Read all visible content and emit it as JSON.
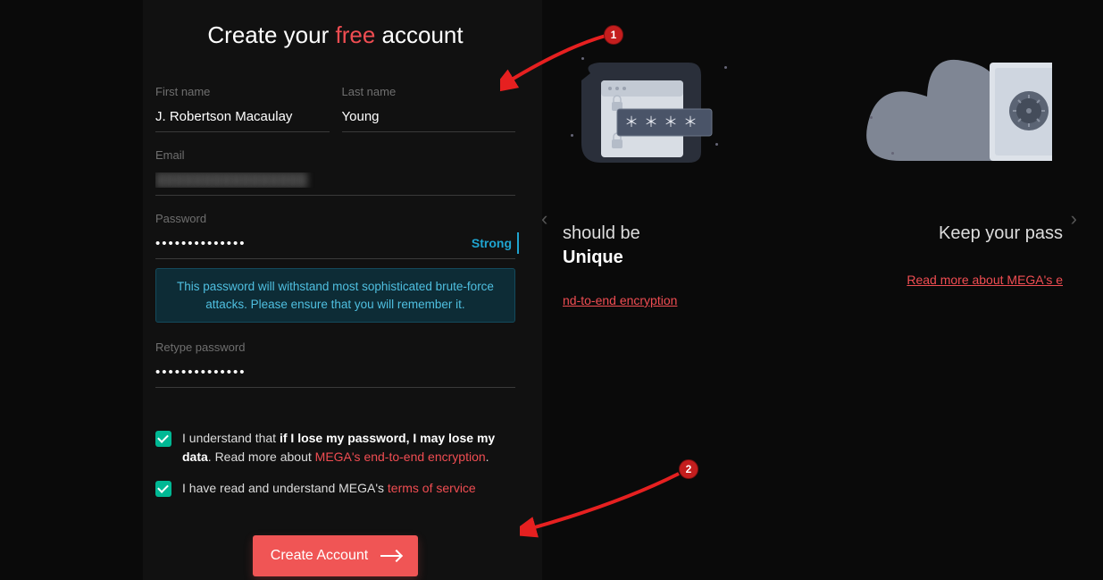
{
  "title": {
    "pre": "Create your ",
    "highlight": "free",
    "post": " account"
  },
  "fields": {
    "first_name": {
      "label": "First name",
      "value": "J. Robertson Macaulay"
    },
    "last_name": {
      "label": "Last name",
      "value": "Young"
    },
    "email": {
      "label": "Email",
      "value": "████████████████"
    },
    "password": {
      "label": "Password",
      "value": "••••••••••••••",
      "strength": "Strong"
    },
    "retype": {
      "label": "Retype password",
      "value": "••••••••••••••"
    }
  },
  "password_tip": "This password will withstand most sophisticated brute-force attacks. Please ensure that you will remember it.",
  "consent1": {
    "pre": "I understand that ",
    "bold": "if I lose my password, I may lose my data",
    "mid": ". Read more about ",
    "link": "MEGA's end-to-end encryption",
    "post": "."
  },
  "consent2": {
    "pre": "I have read and understand MEGA's ",
    "link": "terms of service"
  },
  "create_button": "Create Account",
  "carousel": {
    "card1": {
      "line1": "should be",
      "line2": "Unique",
      "link": "nd-to-end encryption"
    },
    "card2": {
      "line1": "Keep your pass",
      "link": "Read more about MEGA's e"
    }
  },
  "annotations": {
    "m1": "1",
    "m2": "2"
  }
}
